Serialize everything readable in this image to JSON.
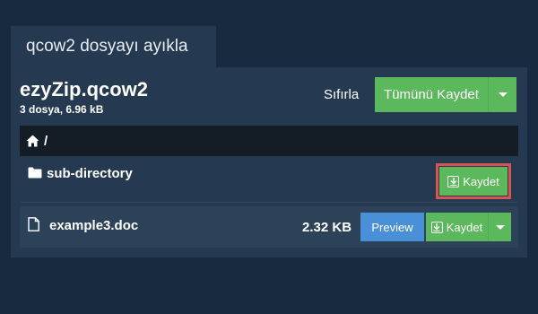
{
  "tab": {
    "title": "qcow2 dosyayı ayıkla"
  },
  "archive": {
    "name": "ezyZip.qcow2",
    "meta": "3 dosya, 6.96 kB"
  },
  "actions": {
    "reset_label": "Sıfırla",
    "save_all_label": "Tümünü Kaydet"
  },
  "path": {
    "separator": "/"
  },
  "entries": [
    {
      "type": "directory",
      "name": "sub-directory",
      "save_label": "Kaydet"
    },
    {
      "type": "file",
      "name": "example3.doc",
      "size": "2.32 KB",
      "preview_label": "Preview",
      "save_label": "Kaydet"
    }
  ],
  "colors": {
    "background": "#172a3f",
    "panel": "#253a51",
    "success": "#5cb85c",
    "primary": "#4a90d9",
    "highlight": "#d9534f"
  },
  "icons": [
    "home-icon",
    "folder-icon",
    "file-icon",
    "download-icon",
    "caret-down-icon"
  ]
}
